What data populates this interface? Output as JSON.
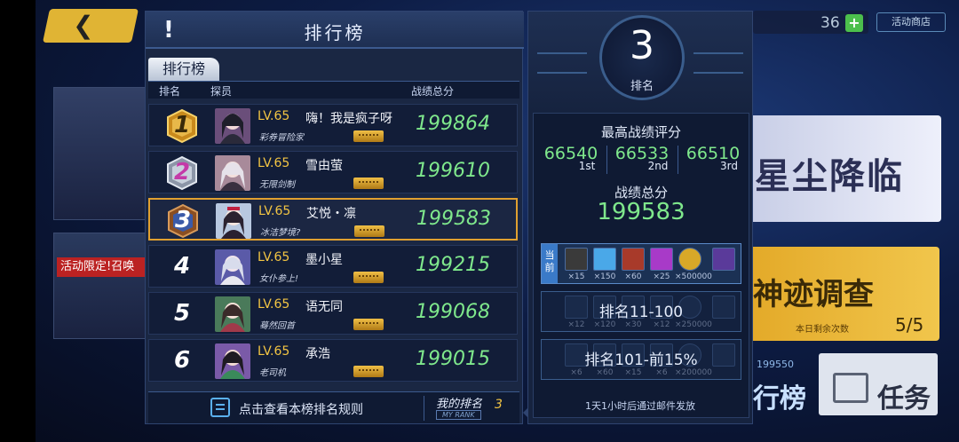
{
  "background": {
    "back_button": "❮",
    "promo_text": "活动限定!召唤",
    "currency_count": "36",
    "plus": "+",
    "shop_label": "活动商店",
    "event1_title": "星尘降临",
    "event2_title": "神迹调查",
    "event2_remaining_label": "本日剩余次数",
    "event2_remaining_value": "5/5",
    "rank_button_label": "行榜",
    "rank_button_score": "199550",
    "task_button_label": "任务"
  },
  "leaderboard": {
    "title": "排行榜",
    "exclaim": "!",
    "tab": "排行榜",
    "columns": {
      "rank": "排名",
      "member": "探员",
      "score": "战绩总分"
    },
    "rows": [
      {
        "rank": "1",
        "level": "LV.65",
        "name": "嗨！我是疯子呀",
        "title": "彩券冒险家",
        "score": "199864"
      },
      {
        "rank": "2",
        "level": "LV.65",
        "name": "雪由萤",
        "title": "无限剑制",
        "score": "199610"
      },
      {
        "rank": "3",
        "level": "LV.65",
        "name": "艾悦・凛",
        "title": "冰洁梦境?",
        "score": "199583"
      },
      {
        "rank": "4",
        "level": "LV.65",
        "name": "墨小星",
        "title": "女仆参上!",
        "score": "199215"
      },
      {
        "rank": "5",
        "level": "LV.65",
        "name": "语无同",
        "title": "蓦然回首",
        "score": "199068"
      },
      {
        "rank": "6",
        "level": "LV.65",
        "name": "承浩",
        "title": "老司机",
        "score": "199015"
      }
    ],
    "footer": {
      "rules_text": "点击查看本榜排名规则",
      "my_rank_label": "我的排名",
      "my_rank_en": "MY RANK",
      "my_rank_value": "3"
    }
  },
  "rank_panel": {
    "rank_value": "3",
    "rank_label": "排名",
    "best_title": "最高战绩评分",
    "best": [
      {
        "value": "66540",
        "place": "1st"
      },
      {
        "value": "66533",
        "place": "2nd"
      },
      {
        "value": "66510",
        "place": "3rd"
      }
    ],
    "total_title": "战绩总分",
    "total_value": "199583",
    "tiers": [
      {
        "tag": "当前",
        "title": "",
        "counts": [
          "×15",
          "×150",
          "×60",
          "×25",
          "×500000",
          ""
        ]
      },
      {
        "tag": "",
        "title": "排名11-100",
        "counts": [
          "×12",
          "×120",
          "×30",
          "×12",
          "×250000",
          ""
        ]
      },
      {
        "tag": "",
        "title": "排名101-前15%",
        "counts": [
          "×6",
          "×60",
          "×15",
          "×6",
          "×200000",
          ""
        ]
      }
    ],
    "footer": "1天1小时后通过邮件发放"
  },
  "colors": {
    "accent_green": "#7fe88c",
    "gold": "#f3c543",
    "my_rank_border": "#e0a030"
  }
}
